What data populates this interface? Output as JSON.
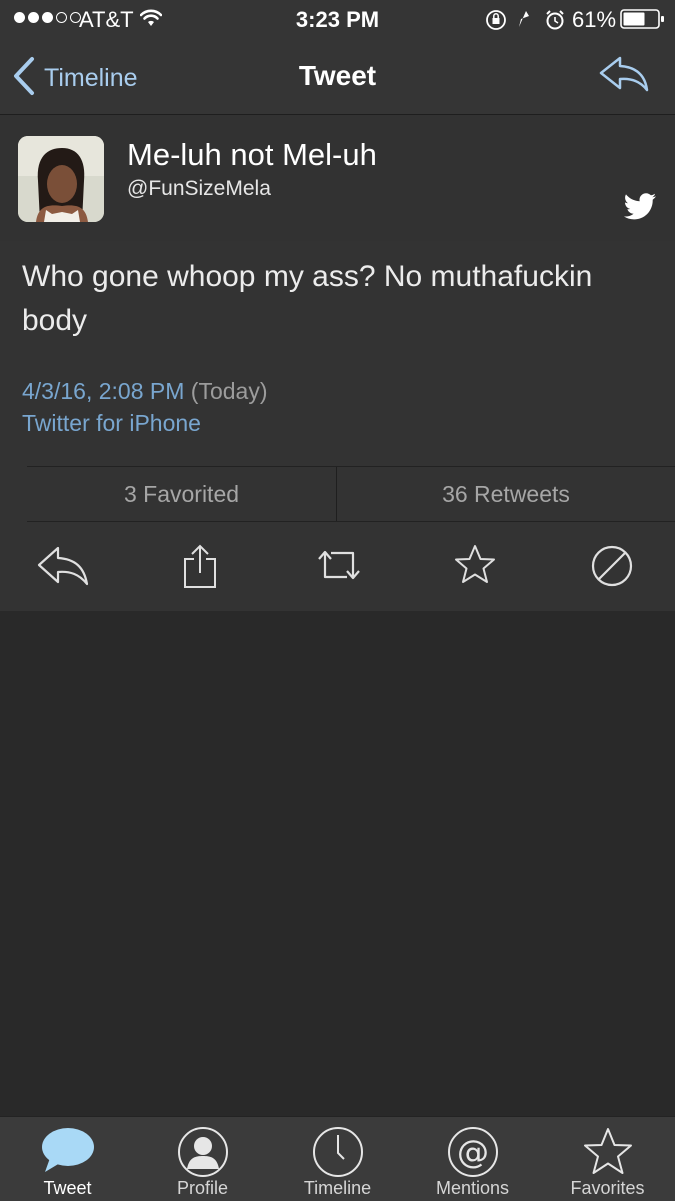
{
  "status_bar": {
    "carrier": "AT&T",
    "time": "3:23 PM",
    "battery": "61%"
  },
  "navbar": {
    "back_label": "Timeline",
    "title": "Tweet"
  },
  "profile": {
    "display_name": "Me-luh not Mel-uh",
    "handle": "@FunSizeMela"
  },
  "tweet": {
    "text": "Who gone whoop my ass? No muthafuckin body",
    "date": "4/3/16, 2:08 PM",
    "relative": "(Today)",
    "source": "Twitter for iPhone"
  },
  "stats": {
    "favorited": "3 Favorited",
    "retweets": "36 Retweets"
  },
  "actions": [
    "reply-icon",
    "share-icon",
    "retweet-icon",
    "favorite-star-icon",
    "block-icon"
  ],
  "tab_bar": {
    "tabs": [
      {
        "label": "Tweet",
        "icon": "speech-bubble-icon"
      },
      {
        "label": "Profile",
        "icon": "person-icon"
      },
      {
        "label": "Timeline",
        "icon": "clock-icon"
      },
      {
        "label": "Mentions",
        "icon": "at-sign-icon"
      },
      {
        "label": "Favorites",
        "icon": "star-icon"
      }
    ]
  },
  "colors": {
    "background": "#292929",
    "bar": "#353535",
    "link": "#79a6cf",
    "back_link": "#a9cdee",
    "bubble": "#a9d9f6"
  }
}
